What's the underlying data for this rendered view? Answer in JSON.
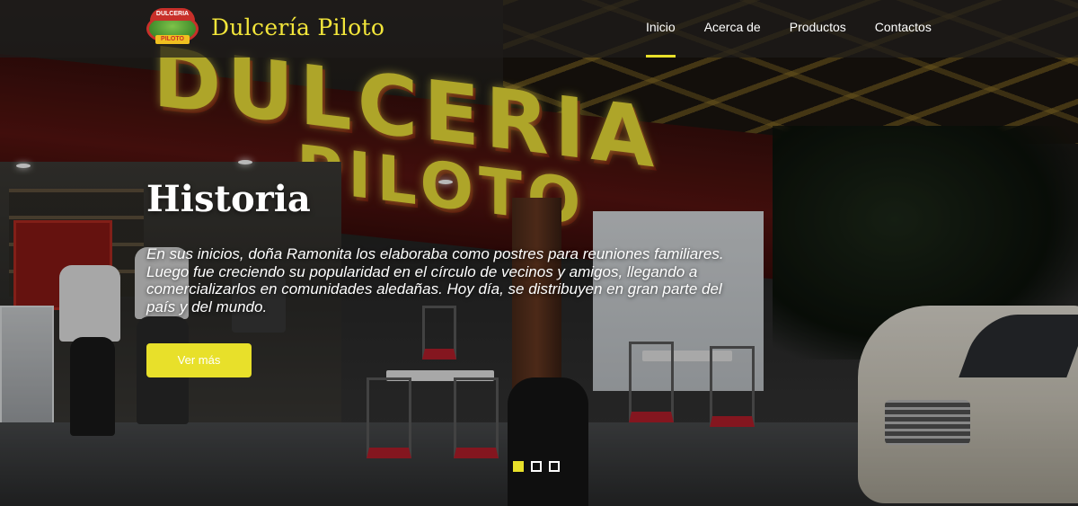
{
  "header": {
    "brand_name": "Dulcería Piloto",
    "logo": {
      "top_text": "DULCERIA",
      "bottom_text": "PILOTO"
    },
    "nav": [
      {
        "label": "Inicio",
        "active": true
      },
      {
        "label": "Acerca de",
        "active": false
      },
      {
        "label": "Productos",
        "active": false
      },
      {
        "label": "Contactos",
        "active": false
      }
    ]
  },
  "background": {
    "sign_line1": "DULCERIA",
    "sign_line2": "PILOTO"
  },
  "hero": {
    "title": "Historia",
    "text": "En sus inicios, doña Ramonita los elaboraba como postres para reuniones familiares. Luego fue creciendo su popularidad en el círculo de vecinos y amigos, llegando a comercializarlos en comunidades aledañas. Hoy día, se distribuyen en gran parte del país y del mundo.",
    "button_label": "Ver más"
  },
  "carousel": {
    "slides": 3,
    "active_index": 0
  },
  "colors": {
    "accent": "#e8e02a",
    "brand_text": "#f2e53a",
    "navbar_bg": "rgba(30,28,26,0.72)"
  }
}
